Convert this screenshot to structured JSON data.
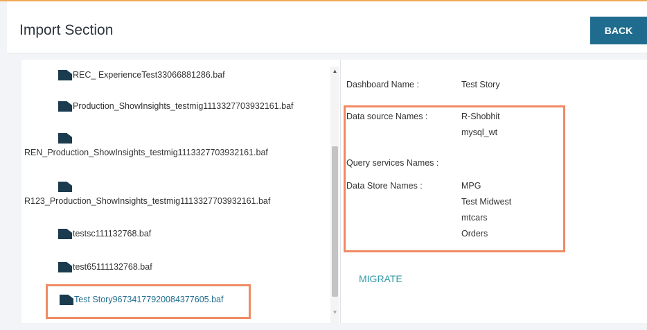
{
  "header": {
    "title": "Import Section",
    "back_label": "BACK"
  },
  "files": [
    "REC_ ExperienceTest33066881286.baf",
    "Production_ShowInsights_testmig1113327703932161.baf",
    "REN_Production_ShowInsights_testmig1113327703932161.baf",
    "R123_Production_ShowInsights_testmig1113327703932161.baf",
    "testsc111132768.baf",
    "test65111132768.baf",
    "Test Story96734177920084377605.baf"
  ],
  "selected_file_index": 6,
  "details": {
    "dashboard_label": "Dashboard Name :",
    "dashboard_value": "Test Story",
    "datasource_label": "Data source Names :",
    "datasource_values": [
      "R-Shobhit",
      "mysql_wt"
    ],
    "query_label": "Query services Names :",
    "datastore_label": "Data Store Names :",
    "datastore_values": [
      "MPG",
      "Test Midwest",
      "mtcars",
      "Orders"
    ]
  },
  "migrate_label": "MIGRATE",
  "colors": {
    "accent": "#1f6c8e",
    "highlight": "#ef8a63",
    "migrate": "#2f9aa8",
    "top_line": "#f0a955"
  }
}
